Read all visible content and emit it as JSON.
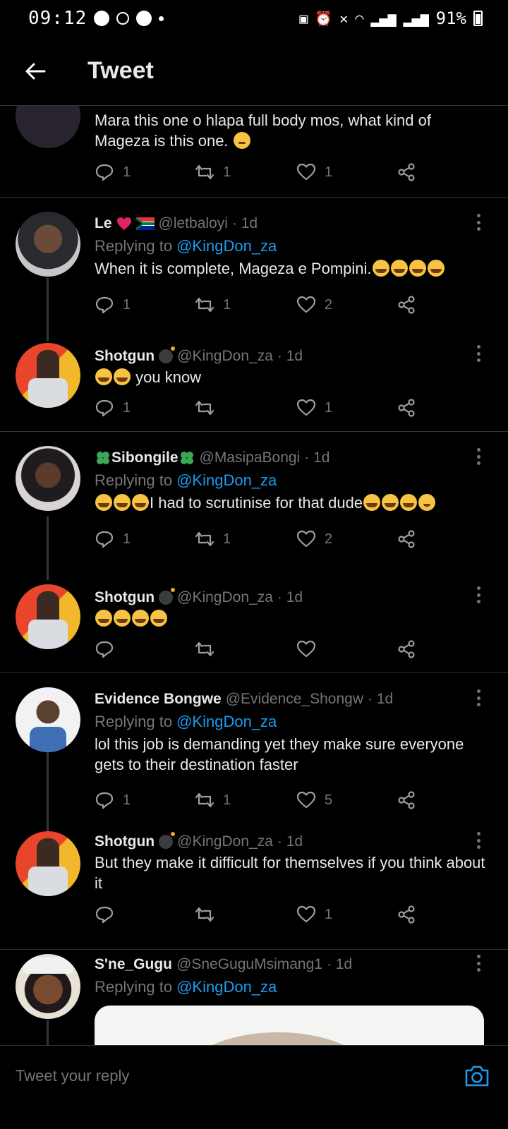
{
  "status_bar": {
    "time": "09:12",
    "battery": "91%"
  },
  "header": {
    "title": "Tweet"
  },
  "tweets": [
    {
      "text_a": "Mara this one o hlapa full body mos, what kind of Mageza is this one.",
      "counts": {
        "reply": "1",
        "retweet": "1",
        "like": "1"
      }
    },
    {
      "name": "Le",
      "handle": "@letbaloyi",
      "time": "· 1d",
      "replying_label": "Replying to",
      "replying_to": "@KingDon_za",
      "text_a": "When it is complete,  Mageza e Pompini.",
      "counts": {
        "reply": "1",
        "retweet": "1",
        "like": "2"
      }
    },
    {
      "name": "Shotgun",
      "handle": "@KingDon_za",
      "time": "· 1d",
      "text_a": "you know",
      "counts": {
        "reply": "1",
        "retweet": "",
        "like": "1"
      }
    },
    {
      "name": "Sibongile",
      "handle": "@MasipaBongi",
      "time": "· 1d",
      "replying_label": "Replying to",
      "replying_to": "@KingDon_za",
      "text_a": "I had to scrutinise for that dude",
      "counts": {
        "reply": "1",
        "retweet": "1",
        "like": "2"
      }
    },
    {
      "name": "Shotgun",
      "handle": "@KingDon_za",
      "time": "· 1d",
      "counts": {
        "reply": "",
        "retweet": "",
        "like": ""
      }
    },
    {
      "name": "Evidence Bongwe",
      "handle": "@Evidence_Shongw",
      "time": "· 1d",
      "replying_label": "Replying to",
      "replying_to": "@KingDon_za",
      "text_a": "lol this job is demanding yet they make sure everyone gets to their destination faster",
      "counts": {
        "reply": "1",
        "retweet": "1",
        "like": "5"
      }
    },
    {
      "name": "Shotgun",
      "handle": "@KingDon_za",
      "time": "· 1d",
      "text_a": "But they make it difficult for themselves if you think about it",
      "counts": {
        "reply": "",
        "retweet": "",
        "like": "1"
      }
    },
    {
      "name": "S'ne_Gugu",
      "handle": "@SneGuguMsimang1",
      "time": "· 1d",
      "replying_label": "Replying to",
      "replying_to": "@KingDon_za"
    }
  ],
  "reply_bar": {
    "placeholder": "Tweet your reply"
  },
  "colors": {
    "link": "#1d9bf0",
    "muted": "#71767b",
    "text": "#e7e9ea",
    "background": "#000000"
  }
}
